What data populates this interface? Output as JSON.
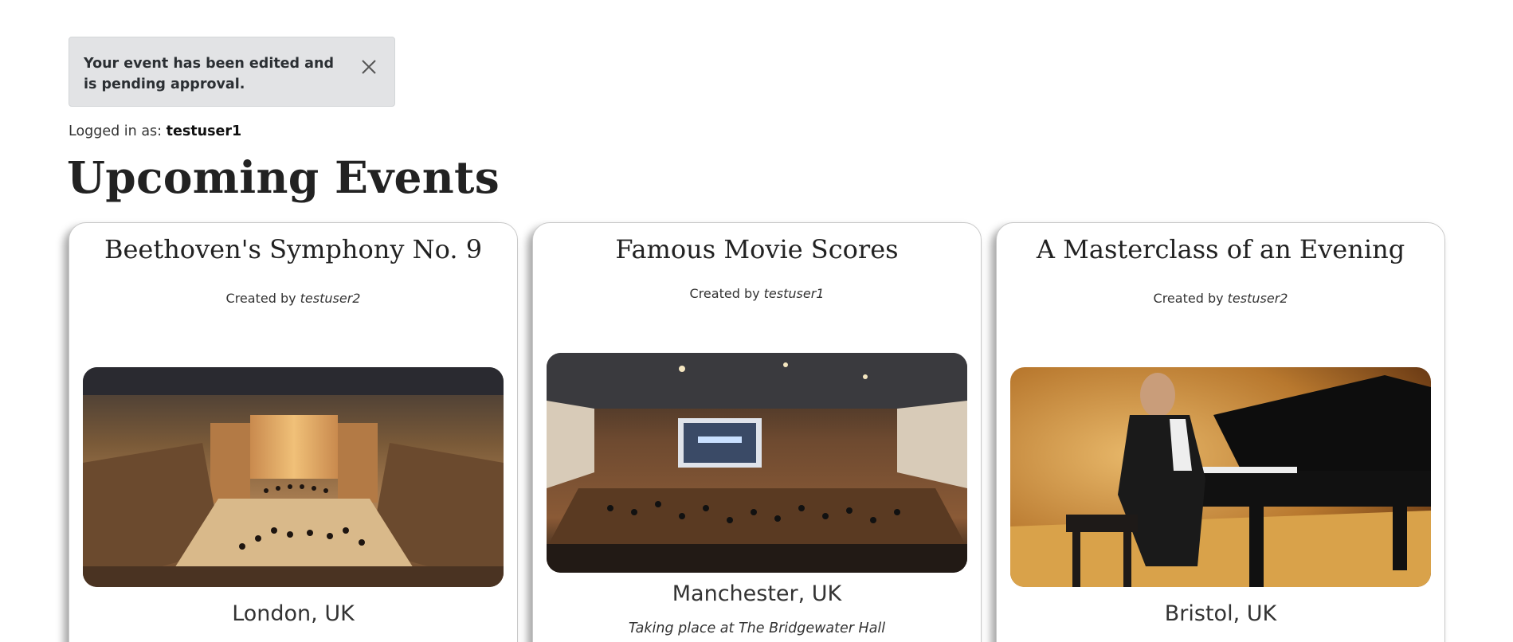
{
  "alert": {
    "message": "Your event has been edited and is pending approval.",
    "close_icon": "close-icon"
  },
  "login": {
    "prefix": "Logged in as:",
    "username": "testuser1"
  },
  "page_title": "Upcoming Events",
  "events": [
    {
      "title": "Beethoven's Symphony No. 9",
      "creator_prefix": "Created by",
      "creator": "testuser2",
      "image_alt": "concert-hall-photo",
      "location": "London, UK"
    },
    {
      "title": "Famous Movie Scores",
      "creator_prefix": "Created by",
      "creator": "testuser1",
      "image_alt": "orchestra-stage-photo",
      "location": "Manchester, UK",
      "venue": "Taking place at The Bridgewater Hall"
    },
    {
      "title": "A Masterclass of an Evening",
      "creator_prefix": "Created by",
      "creator": "testuser2",
      "image_alt": "pianist-photo",
      "location": "Bristol, UK"
    }
  ]
}
